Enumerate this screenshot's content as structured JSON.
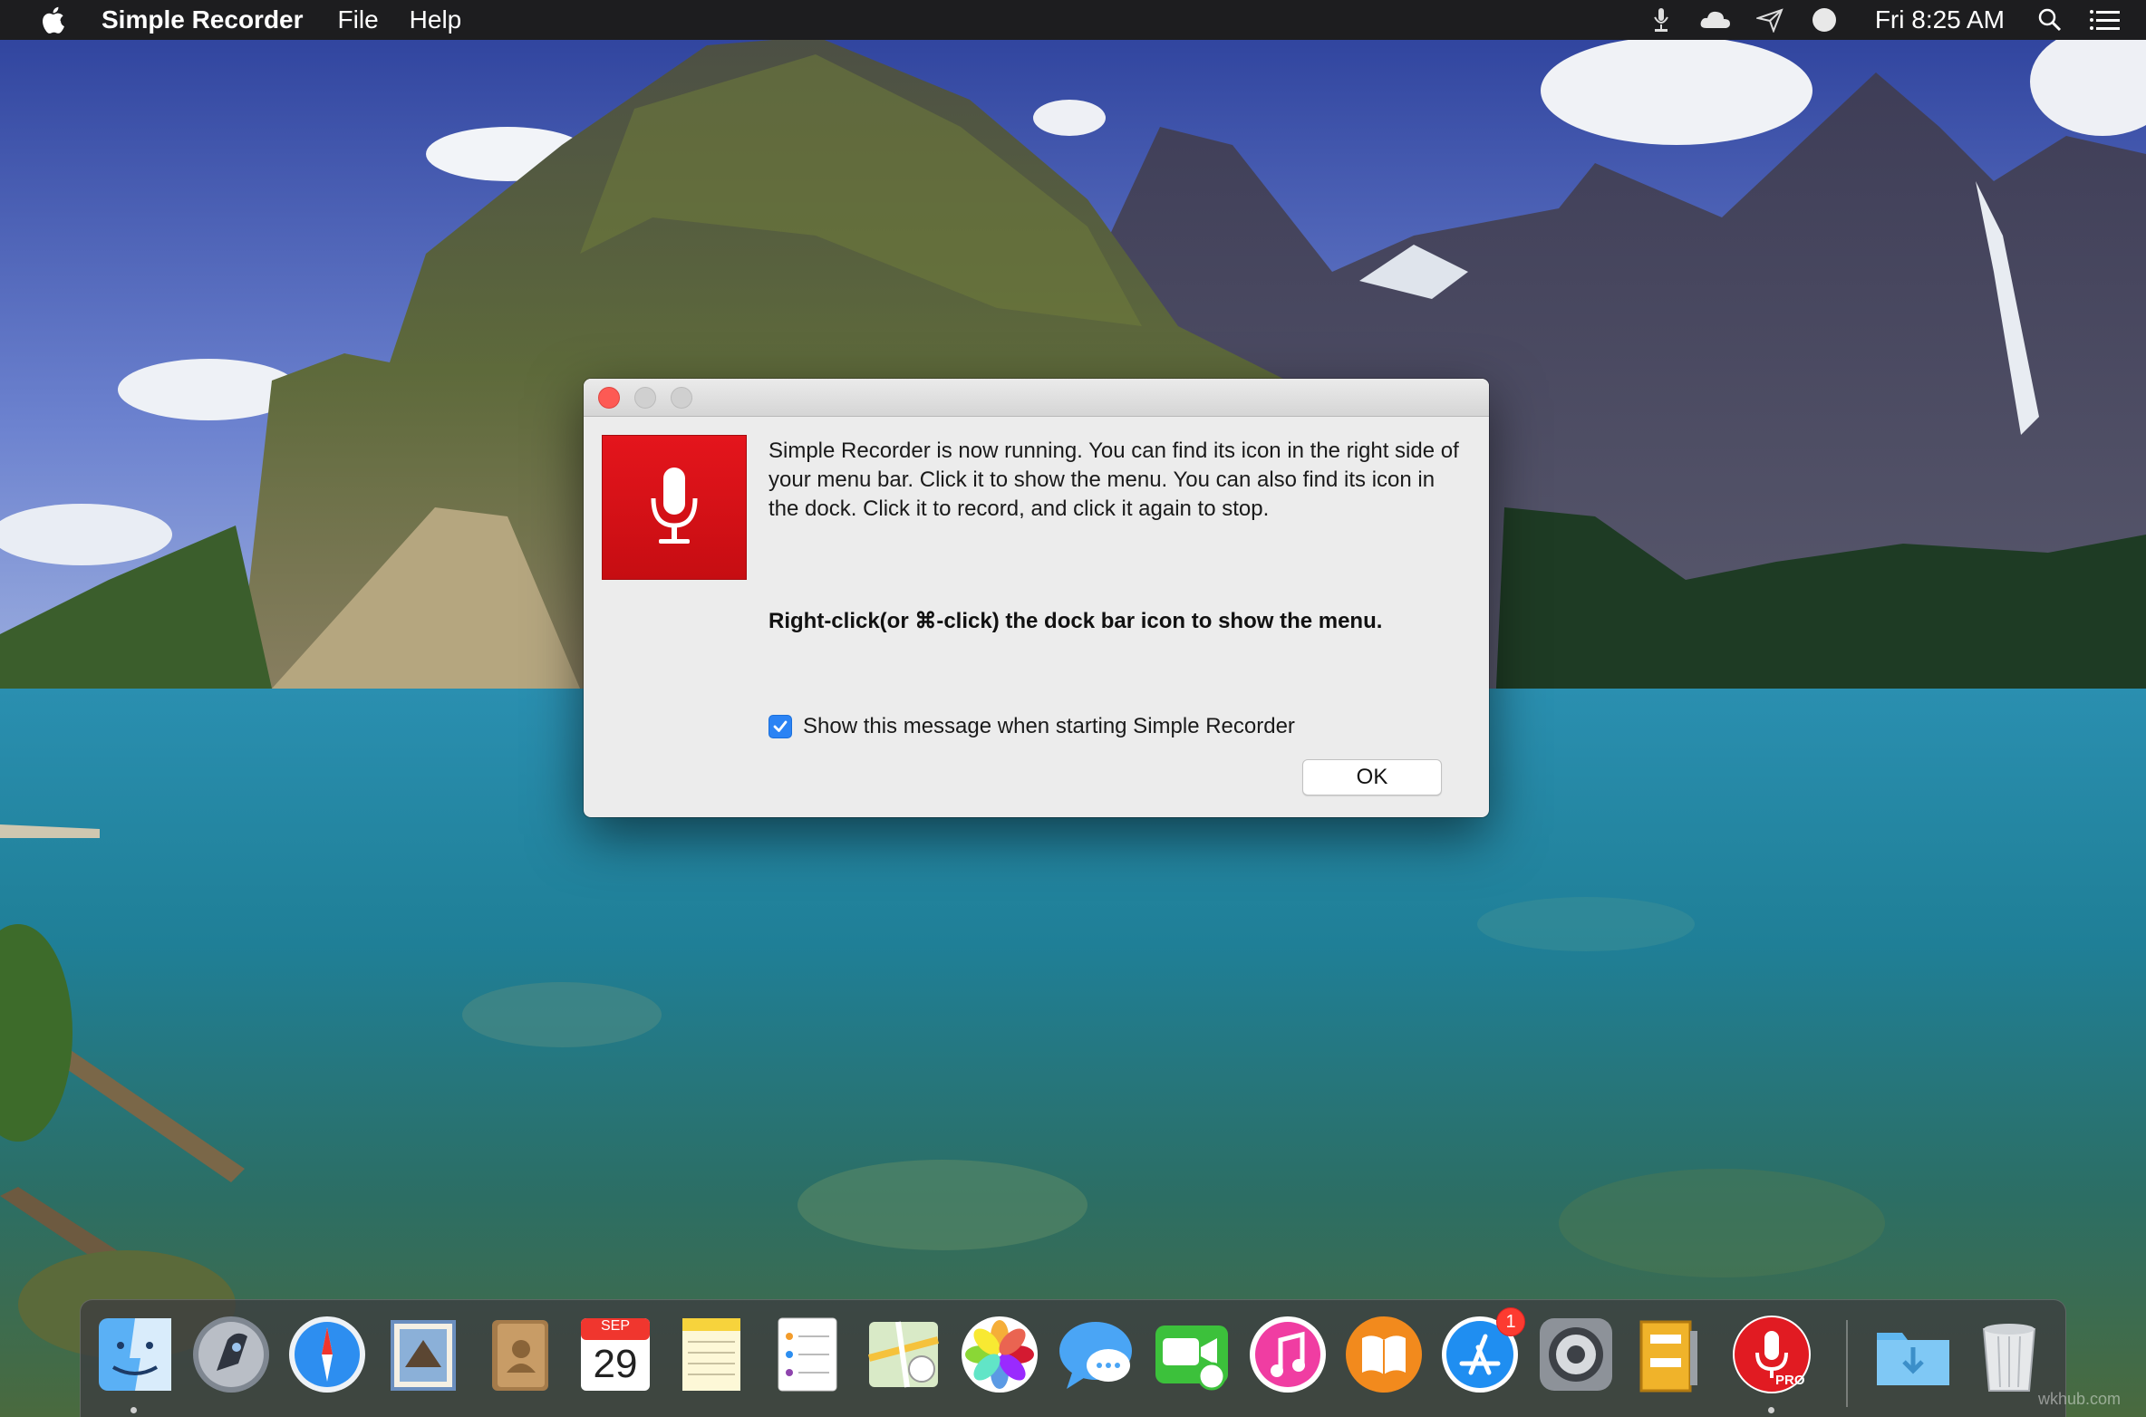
{
  "menubar": {
    "app_name": "Simple Recorder",
    "menus": [
      "File",
      "Help"
    ],
    "clock": "Fri 8:25 AM",
    "status_icons": [
      "microphone-status-icon",
      "cloud-icon",
      "send-icon",
      "circle-status-icon",
      "search-icon",
      "list-icon"
    ]
  },
  "dialog": {
    "message": "Simple Recorder is now running. You can find its icon in the right side of your menu bar. Click it to show the menu. You can also find its icon in the dock. Click it to record, and click it again to stop.",
    "bold_message": "Right-click(or ⌘-click) the dock bar icon to show the menu.",
    "checkbox_label": "Show this message when starting Simple Recorder",
    "checkbox_checked": true,
    "ok_label": "OK"
  },
  "dock": {
    "items": [
      "Finder",
      "Launchpad",
      "Safari",
      "Mail",
      "Contacts",
      "Calendar",
      "Notes",
      "Reminders",
      "Maps",
      "Photos",
      "Messages",
      "FaceTime",
      "iTunes",
      "iBooks",
      "App Store",
      "System Preferences",
      "Archive Utility",
      "Simple Recorder Pro",
      "Downloads",
      "Trash"
    ],
    "calendar_month": "SEP",
    "calendar_day": "29",
    "app_store_badge": "1",
    "pro_label": "PRO"
  },
  "watermark": "wkhub.com"
}
